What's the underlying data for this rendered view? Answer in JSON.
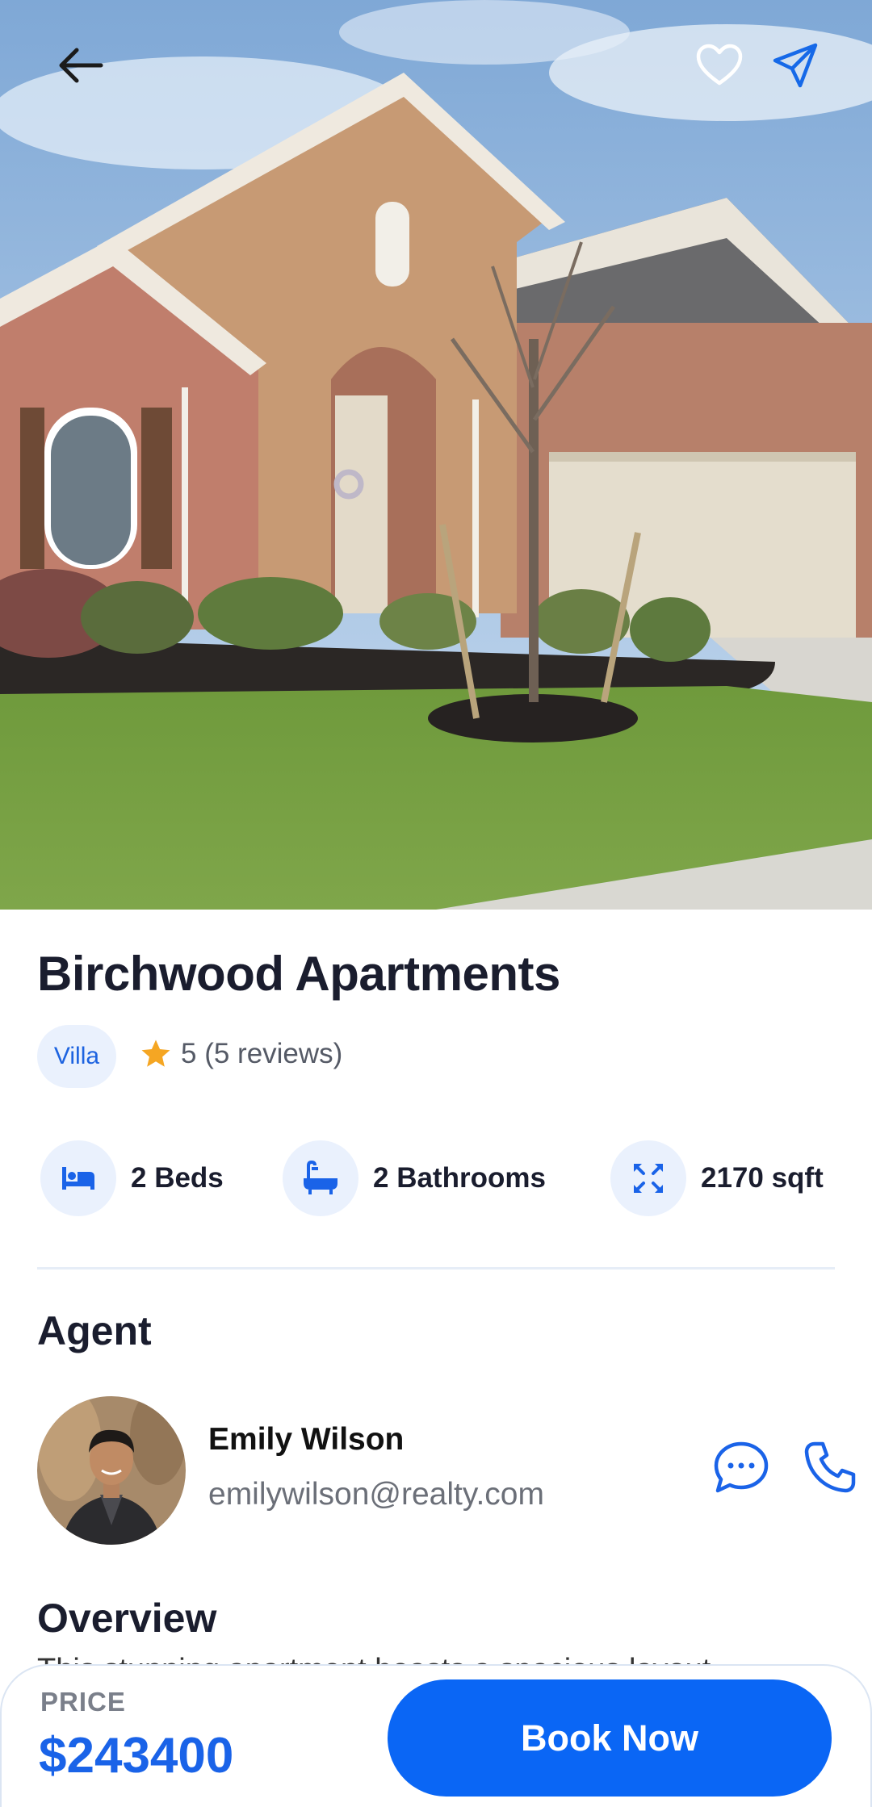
{
  "property": {
    "title": "Birchwood Apartments",
    "type": "Villa",
    "rating_text": "5 (5 reviews)",
    "features": [
      {
        "icon": "bed-icon",
        "label": "2 Beds"
      },
      {
        "icon": "bathtub-icon",
        "label": "2 Bathrooms"
      },
      {
        "icon": "expand-icon",
        "label": "2170 sqft"
      }
    ]
  },
  "agent": {
    "heading": "Agent",
    "name": "Emily Wilson",
    "email": "emilywilson@realty.com"
  },
  "overview": {
    "heading": "Overview",
    "text_peek": "This stunning apartment boasts a spacious layout"
  },
  "booking": {
    "price_label": "PRICE",
    "price": "$243400",
    "button_label": "Book Now"
  },
  "colors": {
    "accent": "#0a66f5",
    "badge_bg": "#eaf1fd",
    "star": "#f5a623",
    "text_dark": "#1a1d2e"
  }
}
